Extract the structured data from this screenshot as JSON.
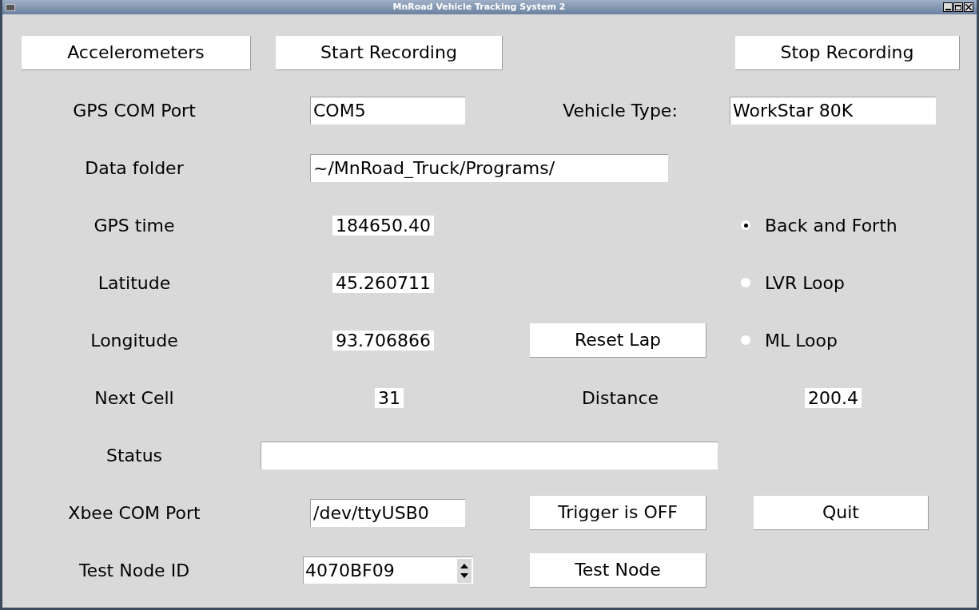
{
  "window": {
    "title": "MnRoad Vehicle Tracking System 2"
  },
  "top_buttons": [
    "Accelerometers",
    "Start Recording",
    "Stop Recording"
  ],
  "gps_com_port": {
    "label": "GPS COM Port",
    "value": "COM5"
  },
  "vehicle_type": {
    "label": "Vehicle Type:",
    "value": "WorkStar 80K"
  },
  "data_folder": {
    "label": "Data folder",
    "value": "~/MnRoad_Truck/Programs/"
  },
  "gps_time": {
    "label": "GPS time",
    "value": "184650.40"
  },
  "latitude": {
    "label": "Latitude",
    "value": "45.260711"
  },
  "longitude": {
    "label": "Longitude",
    "value": "93.706866"
  },
  "route_options": [
    {
      "label": "Back and Forth",
      "selected": true
    },
    {
      "label": "LVR Loop",
      "selected": false
    },
    {
      "label": "ML Loop",
      "selected": false
    }
  ],
  "reset_lap_button": "Reset Lap",
  "next_cell": {
    "label": "Next Cell",
    "value": "31"
  },
  "distance": {
    "label": "Distance",
    "value": "200.4"
  },
  "status": {
    "label": "Status"
  },
  "xbee_com_port": {
    "label": "Xbee COM Port",
    "value": "/dev/ttyUSB0"
  },
  "trigger_button": "Trigger is OFF",
  "quit_button": "Quit",
  "test_node_id": {
    "label": "Test Node ID",
    "value": "4070BF09"
  },
  "test_node_button": "Test Node"
}
